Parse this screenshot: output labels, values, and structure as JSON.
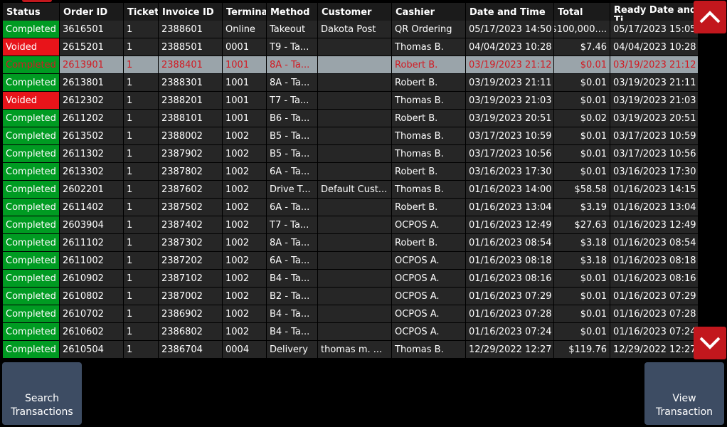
{
  "table": {
    "columns": [
      "Status",
      "Order ID",
      "Ticket",
      "Invoice ID",
      "Terminal",
      "Method",
      "Customer",
      "Cashier",
      "Date and Time",
      "Total",
      "Ready Date and Ti"
    ],
    "rows": [
      {
        "status": "Completed",
        "order_id": "3616501",
        "ticket": "1",
        "invoice_id": "2388601",
        "terminal": "Online",
        "method": "Takeout",
        "customer": "Dakota Post",
        "cashier": "QR Ordering",
        "date_time": "05/17/2023 14:50",
        "total": "$100,000....",
        "ready": "05/17/2023 15:05"
      },
      {
        "status": "Voided",
        "order_id": "2615201",
        "ticket": "1",
        "invoice_id": "2388501",
        "terminal": "0001",
        "method": "T9 - Ta...",
        "customer": "",
        "cashier": "Thomas B.",
        "date_time": "04/04/2023 10:28",
        "total": "$7.46",
        "ready": "04/04/2023 10:28"
      },
      {
        "status": "Completed",
        "order_id": "2613901",
        "ticket": "1",
        "invoice_id": "2388401",
        "terminal": "1001",
        "method": "8A - Ta...",
        "customer": "",
        "cashier": "Robert B.",
        "date_time": "03/19/2023 21:12",
        "total": "$0.01",
        "ready": "03/19/2023 21:12",
        "selected": true
      },
      {
        "status": "Completed",
        "order_id": "2613801",
        "ticket": "1",
        "invoice_id": "2388301",
        "terminal": "1001",
        "method": "8A - Ta...",
        "customer": "",
        "cashier": "Robert B.",
        "date_time": "03/19/2023 21:11",
        "total": "$0.01",
        "ready": "03/19/2023 21:11"
      },
      {
        "status": "Voided",
        "order_id": "2612302",
        "ticket": "1",
        "invoice_id": "2388201",
        "terminal": "1001",
        "method": "T7 - Ta...",
        "customer": "",
        "cashier": "Thomas B.",
        "date_time": "03/19/2023 21:03",
        "total": "$0.01",
        "ready": "03/19/2023 21:03"
      },
      {
        "status": "Completed",
        "order_id": "2611202",
        "ticket": "1",
        "invoice_id": "2388101",
        "terminal": "1001",
        "method": "B6 - Ta...",
        "customer": "",
        "cashier": "Robert B.",
        "date_time": "03/19/2023 20:51",
        "total": "$0.02",
        "ready": "03/19/2023 20:51"
      },
      {
        "status": "Completed",
        "order_id": "2613502",
        "ticket": "1",
        "invoice_id": "2388002",
        "terminal": "1002",
        "method": "B5 - Ta...",
        "customer": "",
        "cashier": "Thomas B.",
        "date_time": "03/17/2023 10:59",
        "total": "$0.01",
        "ready": "03/17/2023 10:59"
      },
      {
        "status": "Completed",
        "order_id": "2611302",
        "ticket": "1",
        "invoice_id": "2387902",
        "terminal": "1002",
        "method": "B5 - Ta...",
        "customer": "",
        "cashier": "Thomas B.",
        "date_time": "03/17/2023 10:56",
        "total": "$0.01",
        "ready": "03/17/2023 10:56"
      },
      {
        "status": "Completed",
        "order_id": "2613302",
        "ticket": "1",
        "invoice_id": "2387802",
        "terminal": "1002",
        "method": "6A - Ta...",
        "customer": "",
        "cashier": "Robert B.",
        "date_time": "03/16/2023 17:30",
        "total": "$0.01",
        "ready": "03/16/2023 17:30"
      },
      {
        "status": "Completed",
        "order_id": "2602201",
        "ticket": "1",
        "invoice_id": "2387602",
        "terminal": "1002",
        "method": "Drive T...",
        "customer": "Default Cust...",
        "cashier": "Thomas B.",
        "date_time": "01/16/2023 14:00",
        "total": "$58.58",
        "ready": "01/16/2023 14:15"
      },
      {
        "status": "Completed",
        "order_id": "2611402",
        "ticket": "1",
        "invoice_id": "2387502",
        "terminal": "1002",
        "method": "6A - Ta...",
        "customer": "",
        "cashier": "Robert B.",
        "date_time": "01/16/2023 13:04",
        "total": "$3.19",
        "ready": "01/16/2023 13:04"
      },
      {
        "status": "Completed",
        "order_id": "2603904",
        "ticket": "1",
        "invoice_id": "2387402",
        "terminal": "1002",
        "method": "T7 - Ta...",
        "customer": "",
        "cashier": "OCPOS A.",
        "date_time": "01/16/2023 12:49",
        "total": "$27.63",
        "ready": "01/16/2023 12:49"
      },
      {
        "status": "Completed",
        "order_id": "2611102",
        "ticket": "1",
        "invoice_id": "2387302",
        "terminal": "1002",
        "method": "8A - Ta...",
        "customer": "",
        "cashier": "Robert B.",
        "date_time": "01/16/2023 08:54",
        "total": "$3.18",
        "ready": "01/16/2023 08:54"
      },
      {
        "status": "Completed",
        "order_id": "2611002",
        "ticket": "1",
        "invoice_id": "2387202",
        "terminal": "1002",
        "method": "6A - Ta...",
        "customer": "",
        "cashier": "OCPOS A.",
        "date_time": "01/16/2023 08:18",
        "total": "$3.18",
        "ready": "01/16/2023 08:18"
      },
      {
        "status": "Completed",
        "order_id": "2610902",
        "ticket": "1",
        "invoice_id": "2387102",
        "terminal": "1002",
        "method": "B4 - Ta...",
        "customer": "",
        "cashier": "OCPOS A.",
        "date_time": "01/16/2023 08:16",
        "total": "$0.01",
        "ready": "01/16/2023 08:16"
      },
      {
        "status": "Completed",
        "order_id": "2610802",
        "ticket": "1",
        "invoice_id": "2387002",
        "terminal": "1002",
        "method": "B2 - Ta...",
        "customer": "",
        "cashier": "OCPOS A.",
        "date_time": "01/16/2023 07:29",
        "total": "$0.01",
        "ready": "01/16/2023 07:29"
      },
      {
        "status": "Completed",
        "order_id": "2610702",
        "ticket": "1",
        "invoice_id": "2386902",
        "terminal": "1002",
        "method": "B4 - Ta...",
        "customer": "",
        "cashier": "OCPOS A.",
        "date_time": "01/16/2023 07:28",
        "total": "$0.01",
        "ready": "01/16/2023 07:28"
      },
      {
        "status": "Completed",
        "order_id": "2610602",
        "ticket": "1",
        "invoice_id": "2386802",
        "terminal": "1002",
        "method": "B4 - Ta...",
        "customer": "",
        "cashier": "OCPOS A.",
        "date_time": "01/16/2023 07:24",
        "total": "$0.01",
        "ready": "01/16/2023 07:24"
      },
      {
        "status": "Completed",
        "order_id": "2610504",
        "ticket": "1",
        "invoice_id": "2386704",
        "terminal": "0004",
        "method": "Delivery",
        "customer": "thomas m. ...",
        "cashier": "Thomas B.",
        "date_time": "12/29/2022 12:27",
        "total": "$119.76",
        "ready": "12/29/2022 12:27"
      }
    ]
  },
  "buttons": {
    "search_line1": "Search",
    "search_line2": "Transactions",
    "view_line1": "View",
    "view_line2": "Transaction"
  },
  "icons": {
    "scroll_up": "chevron-up-icon",
    "scroll_down": "chevron-down-icon"
  },
  "colors": {
    "completed": "#009b22",
    "voided": "#e8141a",
    "selected_row": "#9aa4aa",
    "selected_text": "#d21a22",
    "scroll_button": "#c2171d",
    "action_button": "#3d4c63"
  }
}
